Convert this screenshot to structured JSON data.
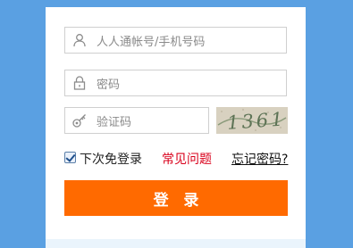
{
  "login_form": {
    "username": {
      "placeholder": "人人通帐号/手机号码",
      "icon": "user-icon"
    },
    "password": {
      "placeholder": "密码",
      "icon": "lock-icon"
    },
    "captcha": {
      "placeholder": "验证码",
      "icon": "key-icon",
      "image_text": "1361"
    },
    "remember_label": "下次免登录",
    "remember_checked": true,
    "faq_link": "常见问题",
    "forgot_link": "忘记密码?",
    "login_button": "登 录"
  },
  "colors": {
    "background": "#5aa0e2",
    "button": "#ff6a00",
    "faq_link": "#d9001b"
  }
}
